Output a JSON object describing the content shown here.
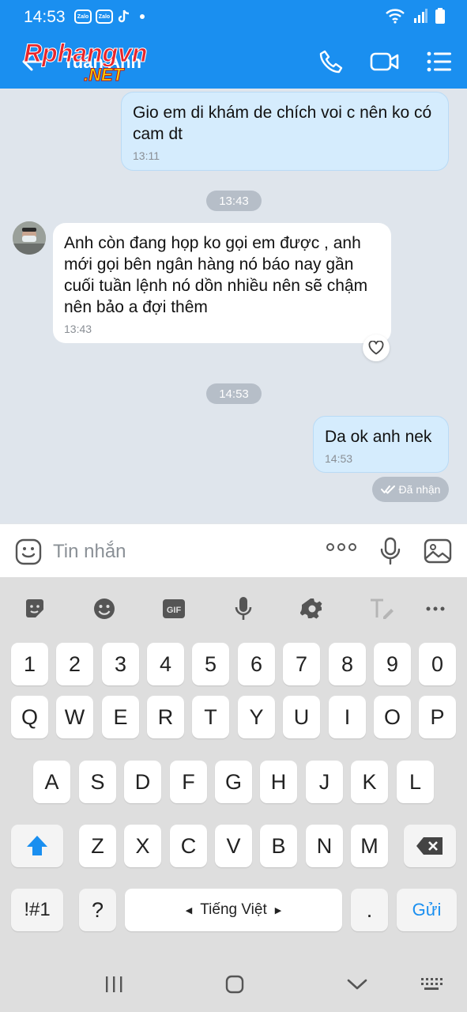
{
  "status_bar": {
    "time": "14:53",
    "zalo_label": "Zalo"
  },
  "header": {
    "contact_name": "Tuấn Anh",
    "watermark": "Rphangvn",
    "watermark_suffix": ".NET"
  },
  "messages": [
    {
      "direction": "out",
      "text": "Gio em di khám de chích voi c nên ko có cam dt",
      "time": "13:11"
    },
    {
      "direction": "in",
      "text": "Anh còn đang họp ko gọi em được , anh mới gọi bên ngân hàng nó báo nay gần cuối tuần lệnh nó dồn nhiều nên sẽ chậm nên bảo a đợi thêm",
      "time": "13:43"
    },
    {
      "direction": "out",
      "text": "Da ok anh nek",
      "time": "14:53"
    }
  ],
  "time_separators": [
    "13:43",
    "14:53"
  ],
  "delivery_status": "Đã nhận",
  "input": {
    "placeholder": "Tin nhắn"
  },
  "keyboard": {
    "gif_label": "GIF",
    "rows": [
      [
        "1",
        "2",
        "3",
        "4",
        "5",
        "6",
        "7",
        "8",
        "9",
        "0"
      ],
      [
        "Q",
        "W",
        "E",
        "R",
        "T",
        "Y",
        "U",
        "I",
        "O",
        "P"
      ],
      [
        "A",
        "S",
        "D",
        "F",
        "G",
        "H",
        "J",
        "K",
        "L"
      ],
      [
        "Z",
        "X",
        "C",
        "V",
        "B",
        "N",
        "M"
      ]
    ],
    "symbols_key": "!#1",
    "question_key": "?",
    "space_label": "Tiếng Việt",
    "period_key": ".",
    "send_key": "Gửi"
  },
  "colors": {
    "header_blue": "#1a8ff0",
    "outgoing_bubble": "#d5ecfd",
    "chat_bg": "#dfe5ec",
    "accent_blue": "#1a8ff0"
  }
}
